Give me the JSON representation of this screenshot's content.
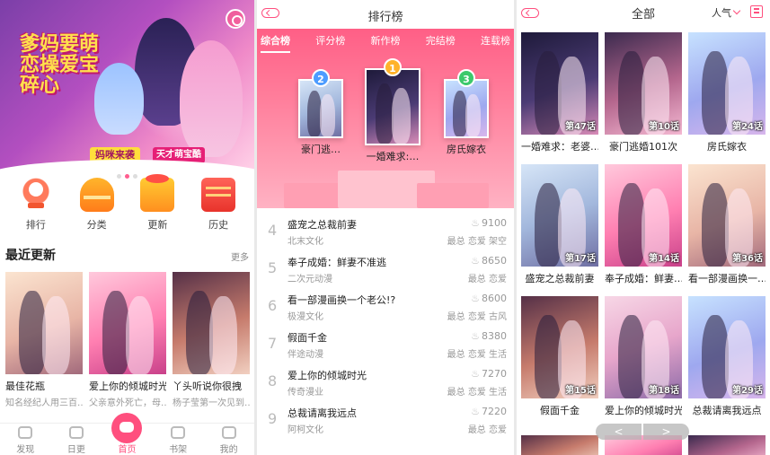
{
  "home": {
    "banner": {
      "art_text": "爹妈要萌恋操爱宝碎心",
      "strip_text": "妈咪来袭",
      "strip_text2": "天才萌宝酷"
    },
    "categories": [
      {
        "label": "排行",
        "icon": "trophy-icon"
      },
      {
        "label": "分类",
        "icon": "category-icon"
      },
      {
        "label": "更新",
        "icon": "update-icon"
      },
      {
        "label": "历史",
        "icon": "history-icon"
      }
    ],
    "section": {
      "title": "最近更新",
      "more": "更多"
    },
    "books": [
      {
        "title": "最佳花瓶",
        "desc": "知名经纪人用三百…"
      },
      {
        "title": "爱上你的倾城时光",
        "desc": "父亲意外死亡，母…"
      },
      {
        "title": "丫头听说你很拽",
        "desc": "杨子莹第一次见到…"
      }
    ],
    "tabs": [
      "发现",
      "日更",
      "首页",
      "书架",
      "我的"
    ]
  },
  "ranking": {
    "title": "排行榜",
    "tabs": [
      "综合榜",
      "评分榜",
      "新作榜",
      "完结榜",
      "连载榜"
    ],
    "top3": [
      {
        "rank": "2",
        "title": "豪门逃…"
      },
      {
        "rank": "1",
        "title": "一婚难求:…"
      },
      {
        "rank": "3",
        "title": "房氏嫁衣"
      }
    ],
    "list": [
      {
        "no": "4",
        "title": "盛宠之总裁前妻",
        "author": "北末文化",
        "hot": "9100",
        "tags": "最总 恋爱 架空"
      },
      {
        "no": "5",
        "title": "奉子成婚：鲜妻不准逃",
        "author": "二次元动漫",
        "hot": "8650",
        "tags": "最总 恋爱"
      },
      {
        "no": "6",
        "title": "看一部漫画换一个老公!?",
        "author": "极漫文化",
        "hot": "8600",
        "tags": "最总 恋爱 古风"
      },
      {
        "no": "7",
        "title": "假面千金",
        "author": "伴途动漫",
        "hot": "8380",
        "tags": "最总 恋爱 生活"
      },
      {
        "no": "8",
        "title": "爱上你的倾城时光",
        "author": "传奇漫业",
        "hot": "7270",
        "tags": "最总 恋爱 生活"
      },
      {
        "no": "9",
        "title": "总裁请离我远点",
        "author": "阿柯文化",
        "hot": "7220",
        "tags": "最总 恋爱"
      }
    ]
  },
  "all": {
    "title": "全部",
    "sort": "人气",
    "items": [
      {
        "title": "一婚难求：老婆…",
        "badge": "第47话"
      },
      {
        "title": "豪门逃婚101次",
        "badge": "第10话"
      },
      {
        "title": "房氏嫁衣",
        "badge": "第24话"
      },
      {
        "title": "盛宠之总裁前妻",
        "badge": "第17话"
      },
      {
        "title": "奉子成婚：鲜妻…",
        "badge": "第14话"
      },
      {
        "title": "看一部漫画换一…",
        "badge": "第36话"
      },
      {
        "title": "假面千金",
        "badge": "第15话"
      },
      {
        "title": "爱上你的倾城时光",
        "badge": "第18话"
      },
      {
        "title": "总裁请离我远点",
        "badge": "第29话"
      }
    ],
    "pager": {
      "prev": "<",
      "next": ">"
    }
  },
  "colors": {
    "accent": "#ff4f7e",
    "gold": "#ffb22a",
    "green": "#3cc96b",
    "blue": "#4d9cff"
  }
}
